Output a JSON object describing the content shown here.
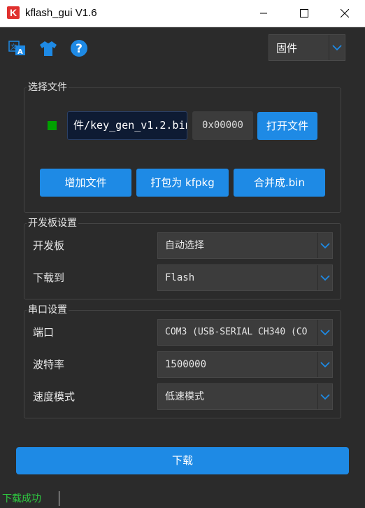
{
  "window": {
    "app_icon_letter": "K",
    "title": "kflash_gui V1.6",
    "minimize_icon": "minimize-icon",
    "maximize_icon": "maximize-icon",
    "close_icon": "close-icon"
  },
  "toolbar": {
    "icons": [
      "translate-icon",
      "shirt-icon",
      "help-icon"
    ],
    "accent_color": "#1e8ae5"
  },
  "mode_select": {
    "value": "固件"
  },
  "file_section": {
    "title": "选择文件",
    "status_color": "#00a000",
    "file_path": "件/key_gen_v1.2.bin",
    "address": "0x00000",
    "open_button": "打开文件",
    "add_button": "增加文件",
    "pack_button": "打包为 kfpkg",
    "merge_button": "合并成.bin"
  },
  "board_section": {
    "title": "开发板设置",
    "board_label": "开发板",
    "board_value": "自动选择",
    "target_label": "下载到",
    "target_value": "Flash"
  },
  "serial_section": {
    "title": "串口设置",
    "port_label": "端口",
    "port_value": "COM3 (USB-SERIAL CH340 (CO",
    "baud_label": "波特率",
    "baud_value": "1500000",
    "speed_label": "速度模式",
    "speed_value": "低速模式"
  },
  "download_button": "下载",
  "status": {
    "text": "下载成功",
    "color": "#2ecc40"
  }
}
